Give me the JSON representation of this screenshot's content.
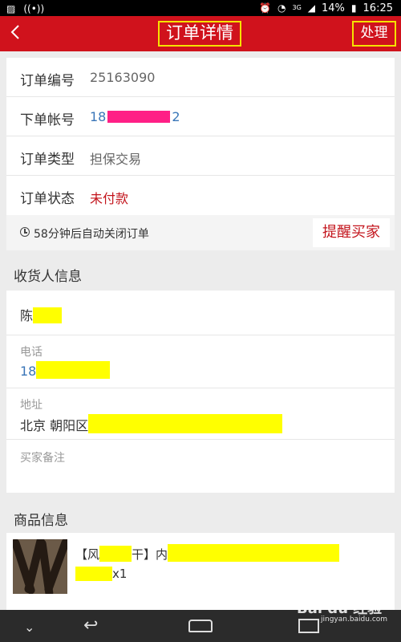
{
  "status_bar": {
    "battery": "14%",
    "time": "16:25",
    "network": "3G"
  },
  "header": {
    "back_icon": "chevron-left-icon",
    "title": "订单详情",
    "action": "处理"
  },
  "order": {
    "rows": [
      {
        "label": "订单编号",
        "value": "25163090"
      },
      {
        "label": "下单帐号",
        "value_prefix": "18",
        "value_suffix": "2"
      },
      {
        "label": "订单类型",
        "value": "担保交易"
      },
      {
        "label": "订单状态",
        "value": "未付款"
      }
    ],
    "timer_text": "58分钟后自动关闭订单",
    "remind_button": "提醒买家"
  },
  "receiver": {
    "section_title": "收货人信息",
    "name_prefix": "陈",
    "phone_label": "电话",
    "phone_prefix": "18",
    "address_label": "地址",
    "address_prefix": "北京 朝阳区",
    "note_label": "买家备注"
  },
  "product": {
    "section_title": "商品信息",
    "name_start": "【风",
    "name_mid": "干】",
    "name_end": "内",
    "quantity": "x1"
  },
  "watermark": {
    "brand": "Bai du 经验",
    "url": "jingyan.baidu.com"
  },
  "colors": {
    "accent": "#d0121c",
    "annotation": "#f5e200",
    "link_blue": "#3a76b8",
    "status_red": "#c3141c"
  }
}
